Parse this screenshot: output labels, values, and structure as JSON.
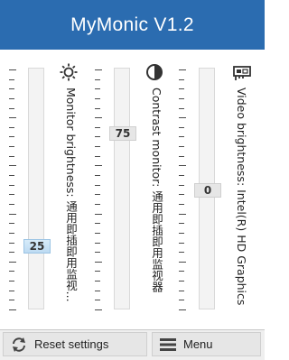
{
  "app": {
    "title": "MyMonic V1.2"
  },
  "sliders": [
    {
      "label": "Monitor brightness: 通用即插即用监视...",
      "value": "25",
      "level": 0.25,
      "icon": "sun-icon",
      "active": true
    },
    {
      "label": "Contrast monitor: 通用即插即用监视器",
      "value": "75",
      "level": 0.75,
      "icon": "contrast-icon",
      "active": false
    },
    {
      "label": "Video brightness: Intel(R) HD Graphics",
      "value": "0",
      "level": 0.5,
      "icon": "graphics-card-icon",
      "active": false
    }
  ],
  "footer": {
    "reset_label": "Reset settings",
    "reset_icon": "refresh-icon",
    "menu_label": "Menu",
    "menu_icon": "hamburger-menu-icon"
  }
}
